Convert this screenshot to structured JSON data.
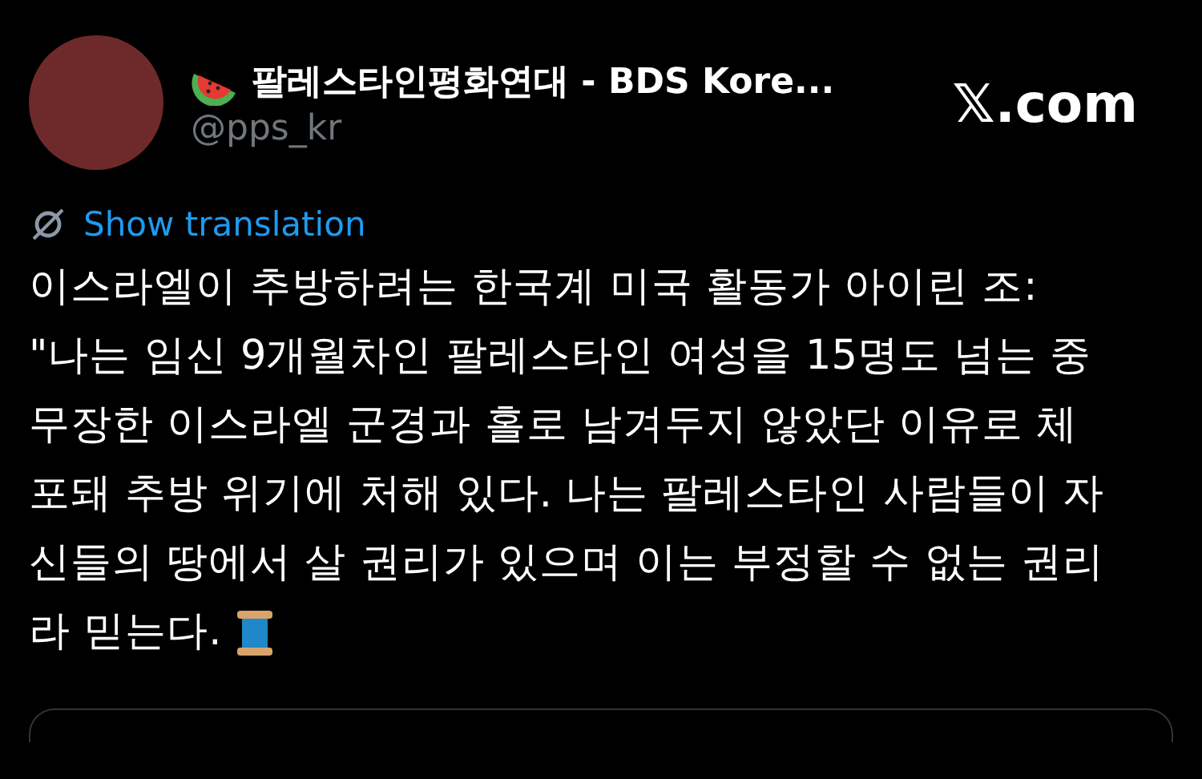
{
  "author": {
    "display_name": "팔레스타인평화연대 - BDS Kore...",
    "handle": "@pps_kr"
  },
  "site_logo": "𝕏.com",
  "translate_link": "Show translation",
  "post_lines": [
    "이스라엘이 추방하려는 한국계 미국 활동가 아이린 조:",
    "\"나는 임신 9개월차인 팔레스타인 여성을 15명도 넘는 중",
    "무장한 이스라엘 군경과 홀로 남겨두지 않았단 이유로 체",
    "포돼 추방 위기에 처해 있다. 나는 팔레스타인 사람들이 자",
    "신들의 땅에서 살 권리가 있으며 이는 부정할 수 없는 권리",
    "라 믿는다."
  ]
}
